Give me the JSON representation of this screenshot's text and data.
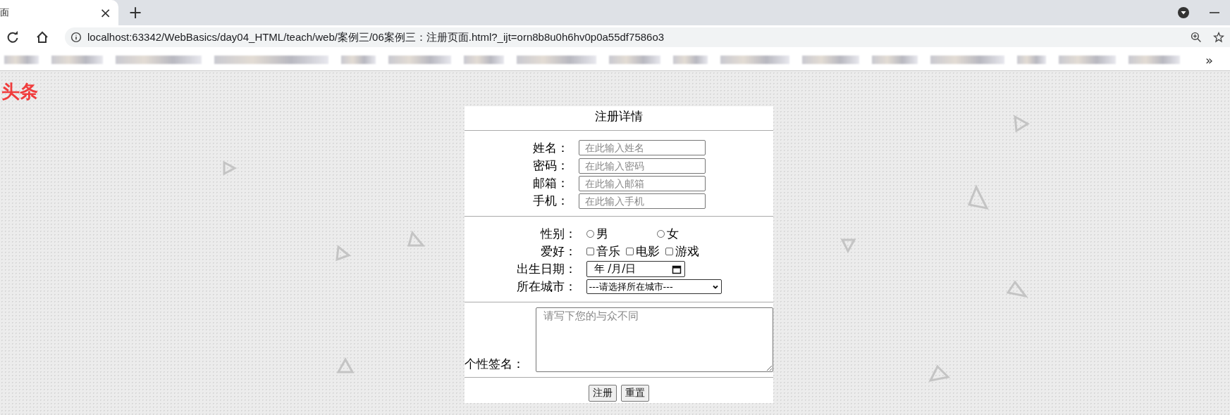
{
  "browser": {
    "tab": {
      "title": "面",
      "close": "×"
    },
    "new_tab": "+",
    "address": "localhost:63342/WebBasics/day04_HTML/teach/web/案例三/06案例三：注册页面.html?_ijt=orn8b8u0h6hv0p0a55df7586o3",
    "bookmarks_overflow": "»"
  },
  "page": {
    "logo": "头条",
    "form": {
      "title": "注册详情",
      "text_fields": [
        {
          "label": "姓名：",
          "placeholder": "在此输入姓名"
        },
        {
          "label": "密码：",
          "placeholder": "在此输入密码"
        },
        {
          "label": "邮箱：",
          "placeholder": "在此输入邮箱"
        },
        {
          "label": "手机：",
          "placeholder": "在此输入手机"
        }
      ],
      "gender": {
        "label": "性别：",
        "options": [
          {
            "label": "男",
            "selected": false
          },
          {
            "label": "女",
            "selected": false
          }
        ]
      },
      "hobbies": {
        "label": "爱好：",
        "options": [
          {
            "label": "音乐",
            "checked": false
          },
          {
            "label": "电影",
            "checked": false
          },
          {
            "label": "游戏",
            "checked": false
          }
        ]
      },
      "birthday": {
        "label": "出生日期：",
        "value": "年 /月/日"
      },
      "city": {
        "label": "所在城市：",
        "value": "---请选择所在城市---"
      },
      "signature": {
        "label": "个性签名：",
        "placeholder": "请写下您的与众不同"
      },
      "buttons": [
        "注册",
        "重置"
      ]
    }
  }
}
